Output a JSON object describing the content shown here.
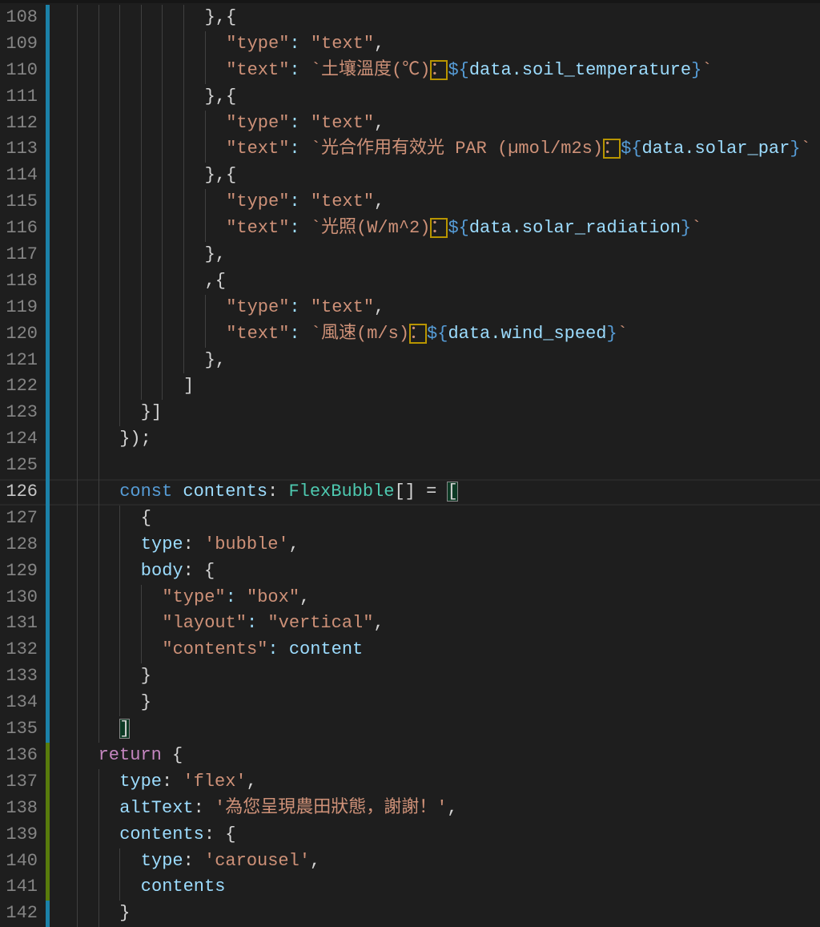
{
  "editor": {
    "active_line": 126,
    "colors": {
      "modified": "#1b81a8",
      "added": "#587c0c",
      "background": "#1e1e1e"
    },
    "lines": [
      {
        "n": "108",
        "indent": 12,
        "gutter": "modified",
        "tokens": [
          [
            "p",
            "},{"
          ]
        ]
      },
      {
        "n": "109",
        "indent": 14,
        "gutter": "modified",
        "tokens": [
          [
            "s",
            "\"type\""
          ],
          [
            "v",
            ": "
          ],
          [
            "s",
            "\"text\""
          ],
          [
            "p",
            ","
          ]
        ]
      },
      {
        "n": "110",
        "indent": 14,
        "gutter": "modified",
        "tokens": [
          [
            "s",
            "\"text\""
          ],
          [
            "v",
            ": "
          ],
          [
            "s",
            "`土壤溫度(℃)"
          ],
          [
            "u",
            "："
          ],
          [
            "k",
            "${"
          ],
          [
            "v",
            "data.soil_temperature"
          ],
          [
            "k",
            "}"
          ],
          [
            "s",
            "`"
          ]
        ]
      },
      {
        "n": "111",
        "indent": 12,
        "gutter": "modified",
        "tokens": [
          [
            "p",
            "},{"
          ]
        ]
      },
      {
        "n": "112",
        "indent": 14,
        "gutter": "modified",
        "tokens": [
          [
            "s",
            "\"type\""
          ],
          [
            "v",
            ": "
          ],
          [
            "s",
            "\"text\""
          ],
          [
            "p",
            ","
          ]
        ]
      },
      {
        "n": "113",
        "indent": 14,
        "gutter": "modified",
        "tokens": [
          [
            "s",
            "\"text\""
          ],
          [
            "v",
            ": "
          ],
          [
            "s",
            "`光合作用有效光 PAR (µmol/m2s)"
          ],
          [
            "u",
            "："
          ],
          [
            "k",
            "${"
          ],
          [
            "v",
            "data.solar_par"
          ],
          [
            "k",
            "}"
          ],
          [
            "s",
            "`"
          ]
        ]
      },
      {
        "n": "114",
        "indent": 12,
        "gutter": "modified",
        "tokens": [
          [
            "p",
            "},{"
          ]
        ]
      },
      {
        "n": "115",
        "indent": 14,
        "gutter": "modified",
        "tokens": [
          [
            "s",
            "\"type\""
          ],
          [
            "v",
            ": "
          ],
          [
            "s",
            "\"text\""
          ],
          [
            "p",
            ","
          ]
        ]
      },
      {
        "n": "116",
        "indent": 14,
        "gutter": "modified",
        "tokens": [
          [
            "s",
            "\"text\""
          ],
          [
            "v",
            ": "
          ],
          [
            "s",
            "`光照(W/m^2)"
          ],
          [
            "u",
            "："
          ],
          [
            "k",
            "${"
          ],
          [
            "v",
            "data.solar_radiation"
          ],
          [
            "k",
            "}"
          ],
          [
            "s",
            "`"
          ]
        ]
      },
      {
        "n": "117",
        "indent": 12,
        "gutter": "modified",
        "tokens": [
          [
            "p",
            "},"
          ]
        ]
      },
      {
        "n": "118",
        "indent": 12,
        "gutter": "modified",
        "tokens": [
          [
            "p",
            ",{"
          ]
        ]
      },
      {
        "n": "119",
        "indent": 14,
        "gutter": "modified",
        "tokens": [
          [
            "s",
            "\"type\""
          ],
          [
            "v",
            ": "
          ],
          [
            "s",
            "\"text\""
          ],
          [
            "p",
            ","
          ]
        ]
      },
      {
        "n": "120",
        "indent": 14,
        "gutter": "modified",
        "tokens": [
          [
            "s",
            "\"text\""
          ],
          [
            "v",
            ": "
          ],
          [
            "s",
            "`風速(m/s)"
          ],
          [
            "u",
            "："
          ],
          [
            "k",
            "${"
          ],
          [
            "v",
            "data.wind_speed"
          ],
          [
            "k",
            "}"
          ],
          [
            "s",
            "`"
          ]
        ]
      },
      {
        "n": "121",
        "indent": 12,
        "gutter": "modified",
        "tokens": [
          [
            "p",
            "},"
          ]
        ]
      },
      {
        "n": "122",
        "indent": 10,
        "gutter": "modified",
        "tokens": [
          [
            "p",
            "]"
          ]
        ]
      },
      {
        "n": "123",
        "indent": 6,
        "gutter": "modified",
        "tokens": [
          [
            "p",
            "}]"
          ]
        ]
      },
      {
        "n": "124",
        "indent": 4,
        "gutter": "modified",
        "tokens": [
          [
            "p",
            "});"
          ]
        ]
      },
      {
        "n": "125",
        "indent": 4,
        "gutter": "modified",
        "tokens": []
      },
      {
        "n": "126",
        "indent": 4,
        "gutter": "modified",
        "tokens": [
          [
            "k",
            "const "
          ],
          [
            "v",
            "contents"
          ],
          [
            "p",
            ": "
          ],
          [
            "t",
            "FlexBubble"
          ],
          [
            "p",
            "[] = "
          ],
          [
            "b",
            "["
          ]
        ]
      },
      {
        "n": "127",
        "indent": 6,
        "gutter": "modified",
        "tokens": [
          [
            "p",
            "{"
          ]
        ]
      },
      {
        "n": "128",
        "indent": 6,
        "gutter": "modified",
        "tokens": [
          [
            "v",
            "type"
          ],
          [
            "p",
            ": "
          ],
          [
            "s",
            "'bubble'"
          ],
          [
            "p",
            ","
          ]
        ]
      },
      {
        "n": "129",
        "indent": 6,
        "gutter": "modified",
        "tokens": [
          [
            "v",
            "body"
          ],
          [
            "p",
            ": {"
          ]
        ]
      },
      {
        "n": "130",
        "indent": 8,
        "gutter": "modified",
        "tokens": [
          [
            "s",
            "\"type\""
          ],
          [
            "v",
            ": "
          ],
          [
            "s",
            "\"box\""
          ],
          [
            "p",
            ","
          ]
        ]
      },
      {
        "n": "131",
        "indent": 8,
        "gutter": "modified",
        "tokens": [
          [
            "s",
            "\"layout\""
          ],
          [
            "v",
            ": "
          ],
          [
            "s",
            "\"vertical\""
          ],
          [
            "p",
            ","
          ]
        ]
      },
      {
        "n": "132",
        "indent": 8,
        "gutter": "modified",
        "tokens": [
          [
            "s",
            "\"contents\""
          ],
          [
            "v",
            ": content"
          ]
        ]
      },
      {
        "n": "133",
        "indent": 6,
        "gutter": "modified",
        "tokens": [
          [
            "p",
            "}"
          ]
        ]
      },
      {
        "n": "134",
        "indent": 6,
        "gutter": "modified",
        "tokens": [
          [
            "p",
            "}"
          ]
        ]
      },
      {
        "n": "135",
        "indent": 4,
        "gutter": "modified",
        "tokens": [
          [
            "b",
            "]"
          ]
        ]
      },
      {
        "n": "136",
        "indent": 2,
        "gutter": "added",
        "tokens": [
          [
            "r",
            "return"
          ],
          [
            "p",
            " {"
          ]
        ]
      },
      {
        "n": "137",
        "indent": 4,
        "gutter": "added",
        "tokens": [
          [
            "v",
            "type"
          ],
          [
            "p",
            ": "
          ],
          [
            "s",
            "'flex'"
          ],
          [
            "p",
            ","
          ]
        ]
      },
      {
        "n": "138",
        "indent": 4,
        "gutter": "added",
        "tokens": [
          [
            "v",
            "altText"
          ],
          [
            "p",
            ": "
          ],
          [
            "s",
            "'為您呈現農田狀態，謝謝！'"
          ],
          [
            "p",
            ","
          ]
        ]
      },
      {
        "n": "139",
        "indent": 4,
        "gutter": "added",
        "tokens": [
          [
            "v",
            "contents"
          ],
          [
            "p",
            ": {"
          ]
        ]
      },
      {
        "n": "140",
        "indent": 6,
        "gutter": "added",
        "tokens": [
          [
            "v",
            "type"
          ],
          [
            "p",
            ": "
          ],
          [
            "s",
            "'carousel'"
          ],
          [
            "p",
            ","
          ]
        ]
      },
      {
        "n": "141",
        "indent": 6,
        "gutter": "added",
        "tokens": [
          [
            "v",
            "contents"
          ]
        ]
      },
      {
        "n": "142",
        "indent": 4,
        "gutter": "modified",
        "tokens": [
          [
            "p",
            "}"
          ]
        ]
      }
    ]
  }
}
